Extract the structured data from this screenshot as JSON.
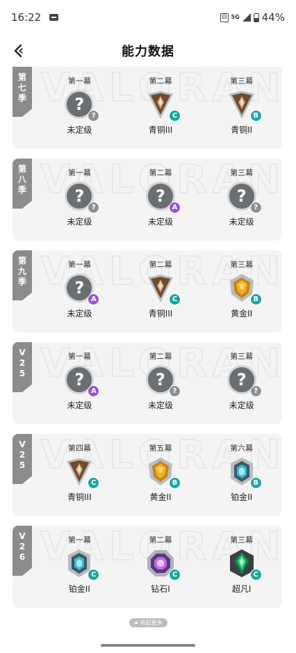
{
  "status_bar": {
    "time": "16:22",
    "network": "5G",
    "battery": "44%"
  },
  "header": {
    "title": "能力数据"
  },
  "watermark": "VALORANT",
  "seasons": [
    {
      "tag": "第七季",
      "acts": [
        {
          "act": "第一幕",
          "rank": "未定级",
          "icon": "unranked-icon",
          "tier": "?"
        },
        {
          "act": "第二幕",
          "rank": "青铜III",
          "icon": "bronze-rank-icon",
          "tier": "C"
        },
        {
          "act": "第三幕",
          "rank": "青铜II",
          "icon": "bronze-rank-icon",
          "tier": "B"
        }
      ]
    },
    {
      "tag": "第八季",
      "acts": [
        {
          "act": "第一幕",
          "rank": "未定级",
          "icon": "unranked-icon",
          "tier": "?"
        },
        {
          "act": "第二幕",
          "rank": "未定级",
          "icon": "unranked-icon",
          "tier": "A"
        },
        {
          "act": "第三幕",
          "rank": "未定级",
          "icon": "unranked-icon",
          "tier": "?"
        }
      ]
    },
    {
      "tag": "第九季",
      "acts": [
        {
          "act": "第一幕",
          "rank": "未定级",
          "icon": "unranked-icon",
          "tier": "A"
        },
        {
          "act": "第二幕",
          "rank": "青铜III",
          "icon": "bronze-rank-icon",
          "tier": "C"
        },
        {
          "act": "第三幕",
          "rank": "黄金II",
          "icon": "gold-rank-icon",
          "tier": "B"
        }
      ]
    },
    {
      "tag": "V25",
      "acts": [
        {
          "act": "第一幕",
          "rank": "未定级",
          "icon": "unranked-icon",
          "tier": "A"
        },
        {
          "act": "第二幕",
          "rank": "未定级",
          "icon": "unranked-icon",
          "tier": "?"
        },
        {
          "act": "第三幕",
          "rank": "未定级",
          "icon": "unranked-icon",
          "tier": "?"
        }
      ]
    },
    {
      "tag": "V25",
      "acts": [
        {
          "act": "第四幕",
          "rank": "青铜III",
          "icon": "bronze-rank-icon",
          "tier": "C"
        },
        {
          "act": "第五幕",
          "rank": "黄金II",
          "icon": "gold-rank-icon",
          "tier": "B"
        },
        {
          "act": "第六幕",
          "rank": "铂金II",
          "icon": "platinum-rank-icon",
          "tier": "B"
        }
      ]
    },
    {
      "tag": "V26",
      "acts": [
        {
          "act": "第一幕",
          "rank": "铂金II",
          "icon": "platinum-rank-icon",
          "tier": "C"
        },
        {
          "act": "第二幕",
          "rank": "钻石I",
          "icon": "diamond-rank-icon",
          "tier": "C"
        },
        {
          "act": "第三幕",
          "rank": "超凡I",
          "icon": "ascendant-rank-icon",
          "tier": "C"
        }
      ]
    }
  ],
  "collapse_label": "收起更多",
  "colors": {
    "tier_a": "#9a52d8",
    "tier_b": "#1aa4ad",
    "tier_c": "#14a99a",
    "season_tag": "#8c8c8c"
  }
}
